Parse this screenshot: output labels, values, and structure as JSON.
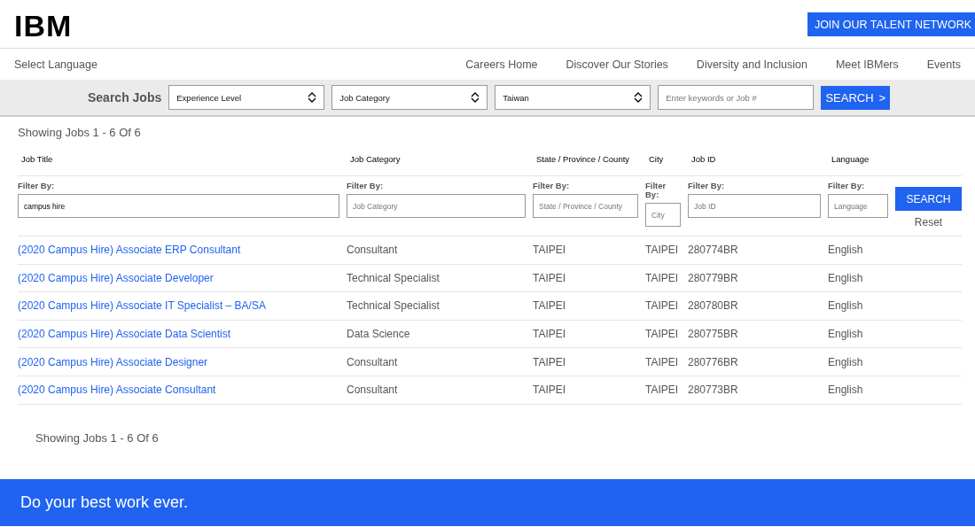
{
  "header": {
    "logo": "IBM",
    "join_button": "JOIN OUR TALENT NETWORK"
  },
  "nav": {
    "language": "Select Language",
    "links": [
      "Careers Home",
      "Discover Our Stories",
      "Diversity and Inclusion",
      "Meet IBMers",
      "Events"
    ]
  },
  "search_bar": {
    "title": "Search Jobs",
    "selects": [
      {
        "value": "Experience Level"
      },
      {
        "value": "Job Category"
      },
      {
        "value": "Taiwan"
      }
    ],
    "keyword": {
      "placeholder": "Enter keywords or Job #"
    },
    "button": "SEARCH",
    "button_icon": ">"
  },
  "summary_top": "Showing Jobs 1 - 6 Of 6",
  "table": {
    "columns": [
      {
        "label": "Job Title",
        "filter_label": "Filter By:",
        "filter_value": "campus hire"
      },
      {
        "label": "Job Category",
        "filter_label": "Filter By:",
        "filter_placeholder": "Job Category"
      },
      {
        "label": "State / Province / County",
        "filter_label": "Filter By:",
        "filter_placeholder": "State / Province / County"
      },
      {
        "label": "City",
        "filter_label": "Filter By:",
        "filter_placeholder": "City"
      },
      {
        "label": "Job ID",
        "filter_label": "Filter By:",
        "filter_placeholder": "Job ID"
      },
      {
        "label": "Language",
        "filter_label": "Filter By:",
        "filter_placeholder": "Language"
      }
    ],
    "search_button": "SEARCH",
    "reset": "Reset",
    "rows": [
      [
        "(2020 Campus Hire) Associate ERP Consultant",
        "Consultant",
        "TAIPEI",
        "TAIPEI",
        "280774BR",
        "English"
      ],
      [
        "(2020 Campus Hire) Associate Developer",
        "Technical Specialist",
        "TAIPEI",
        "TAIPEI",
        "280779BR",
        "English"
      ],
      [
        "(2020 Campus Hire) Associate IT Specialist – BA/SA",
        "Technical Specialist",
        "TAIPEI",
        "TAIPEI",
        "280780BR",
        "English"
      ],
      [
        "(2020 Campus Hire) Associate Data Scientist",
        "Data Science",
        "TAIPEI",
        "TAIPEI",
        "280775BR",
        "English"
      ],
      [
        "(2020 Campus Hire) Associate Designer",
        "Consultant",
        "TAIPEI",
        "TAIPEI",
        "280776BR",
        "English"
      ],
      [
        "(2020 Campus Hire) Associate Consultant",
        "Consultant",
        "TAIPEI",
        "TAIPEI",
        "280773BR",
        "English"
      ]
    ]
  },
  "summary_bottom": "Showing Jobs 1 - 6 Of 6",
  "footer": {
    "tagline": "Do your best work ever."
  }
}
